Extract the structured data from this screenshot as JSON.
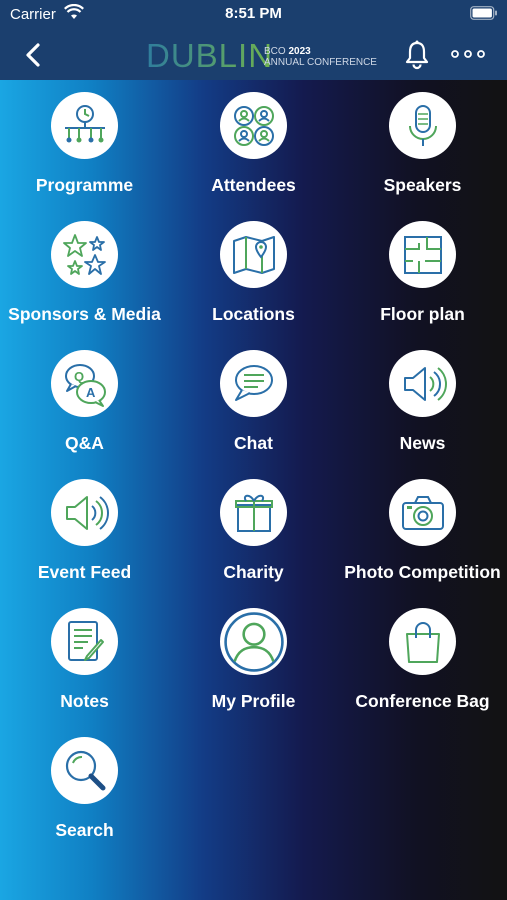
{
  "status": {
    "carrier": "Carrier",
    "time": "8:51 PM"
  },
  "header": {
    "logo_word": "DUBLIN",
    "logo_line1_prefix": "BCO ",
    "logo_line1_year": "2023",
    "logo_line2": "ANNUAL CONFERENCE"
  },
  "tiles": [
    {
      "label": "Programme",
      "icon": "programme-icon"
    },
    {
      "label": "Attendees",
      "icon": "attendees-icon"
    },
    {
      "label": "Speakers",
      "icon": "microphone-icon"
    },
    {
      "label": "Sponsors & Media",
      "icon": "stars-icon"
    },
    {
      "label": "Locations",
      "icon": "map-icon"
    },
    {
      "label": "Floor plan",
      "icon": "floor-plan-icon"
    },
    {
      "label": "Q&A",
      "icon": "qa-bubbles-icon"
    },
    {
      "label": "Chat",
      "icon": "chat-bubble-icon"
    },
    {
      "label": "News",
      "icon": "speaker-icon"
    },
    {
      "label": "Event Feed",
      "icon": "speaker-icon"
    },
    {
      "label": "Charity",
      "icon": "gift-icon"
    },
    {
      "label": "Photo Competition",
      "icon": "camera-icon"
    },
    {
      "label": "Notes",
      "icon": "notes-icon"
    },
    {
      "label": "My Profile",
      "icon": "profile-icon"
    },
    {
      "label": "Conference Bag",
      "icon": "bag-icon"
    },
    {
      "label": "Search",
      "icon": "search-icon"
    }
  ],
  "colors": {
    "icon_green": "#4fa65b",
    "icon_blue": "#2a6fa8",
    "header_bg": "#1b3f6e"
  }
}
